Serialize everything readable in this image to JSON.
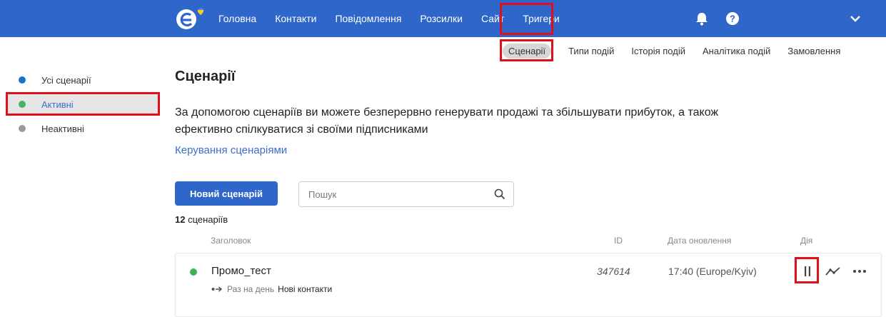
{
  "header": {
    "nav": [
      {
        "label": "Головна"
      },
      {
        "label": "Контакти"
      },
      {
        "label": "Повідомлення"
      },
      {
        "label": "Розсилки"
      },
      {
        "label": "Сайт"
      },
      {
        "label": "Тригери",
        "active": true
      }
    ],
    "icons": [
      "logo-icon",
      "bell-icon",
      "help-icon",
      "chevron-down-icon"
    ],
    "colors": {
      "bar": "#2f66c9",
      "logo_accent": "#f5d218"
    }
  },
  "subnav": {
    "items": [
      {
        "label": "Сценарії",
        "current": true
      },
      {
        "label": "Типи подій"
      },
      {
        "label": "Історія подій"
      },
      {
        "label": "Аналітика подій"
      },
      {
        "label": "Замовлення"
      }
    ]
  },
  "sidebar": {
    "items": [
      {
        "label": "Усі сценарії",
        "dot_color": "#1a73c9"
      },
      {
        "label": "Активні",
        "dot_color": "#4cb163",
        "active": true
      },
      {
        "label": "Неактивні",
        "dot_color": "#9b9b9b"
      }
    ]
  },
  "main": {
    "title": "Сценарії",
    "description": "За допомогою сценаріїв ви можете безперервно генерувати продажі та збільшувати прибуток, а також ефективно спілкуватися зі своїми підписниками",
    "manage_link": "Керування сценаріями",
    "new_button": "Новий сценарій",
    "search": {
      "placeholder": "Пошук",
      "value": ""
    },
    "count": {
      "number": "12",
      "label": "сценаріїв"
    },
    "columns": {
      "title": "Заголовок",
      "id": "ID",
      "date": "Дата оновлення",
      "action": "Дія"
    },
    "rows": [
      {
        "name": "Промо_тест",
        "frequency": "Раз на день",
        "target": "Нові контакти",
        "id": "347614",
        "updated": "17:40 (Europe/Kyiv)",
        "status_color": "#3cb35a",
        "actions": [
          "pause-icon",
          "analytics-icon",
          "more-icon"
        ]
      }
    ]
  },
  "highlight_color": "#e0101a"
}
